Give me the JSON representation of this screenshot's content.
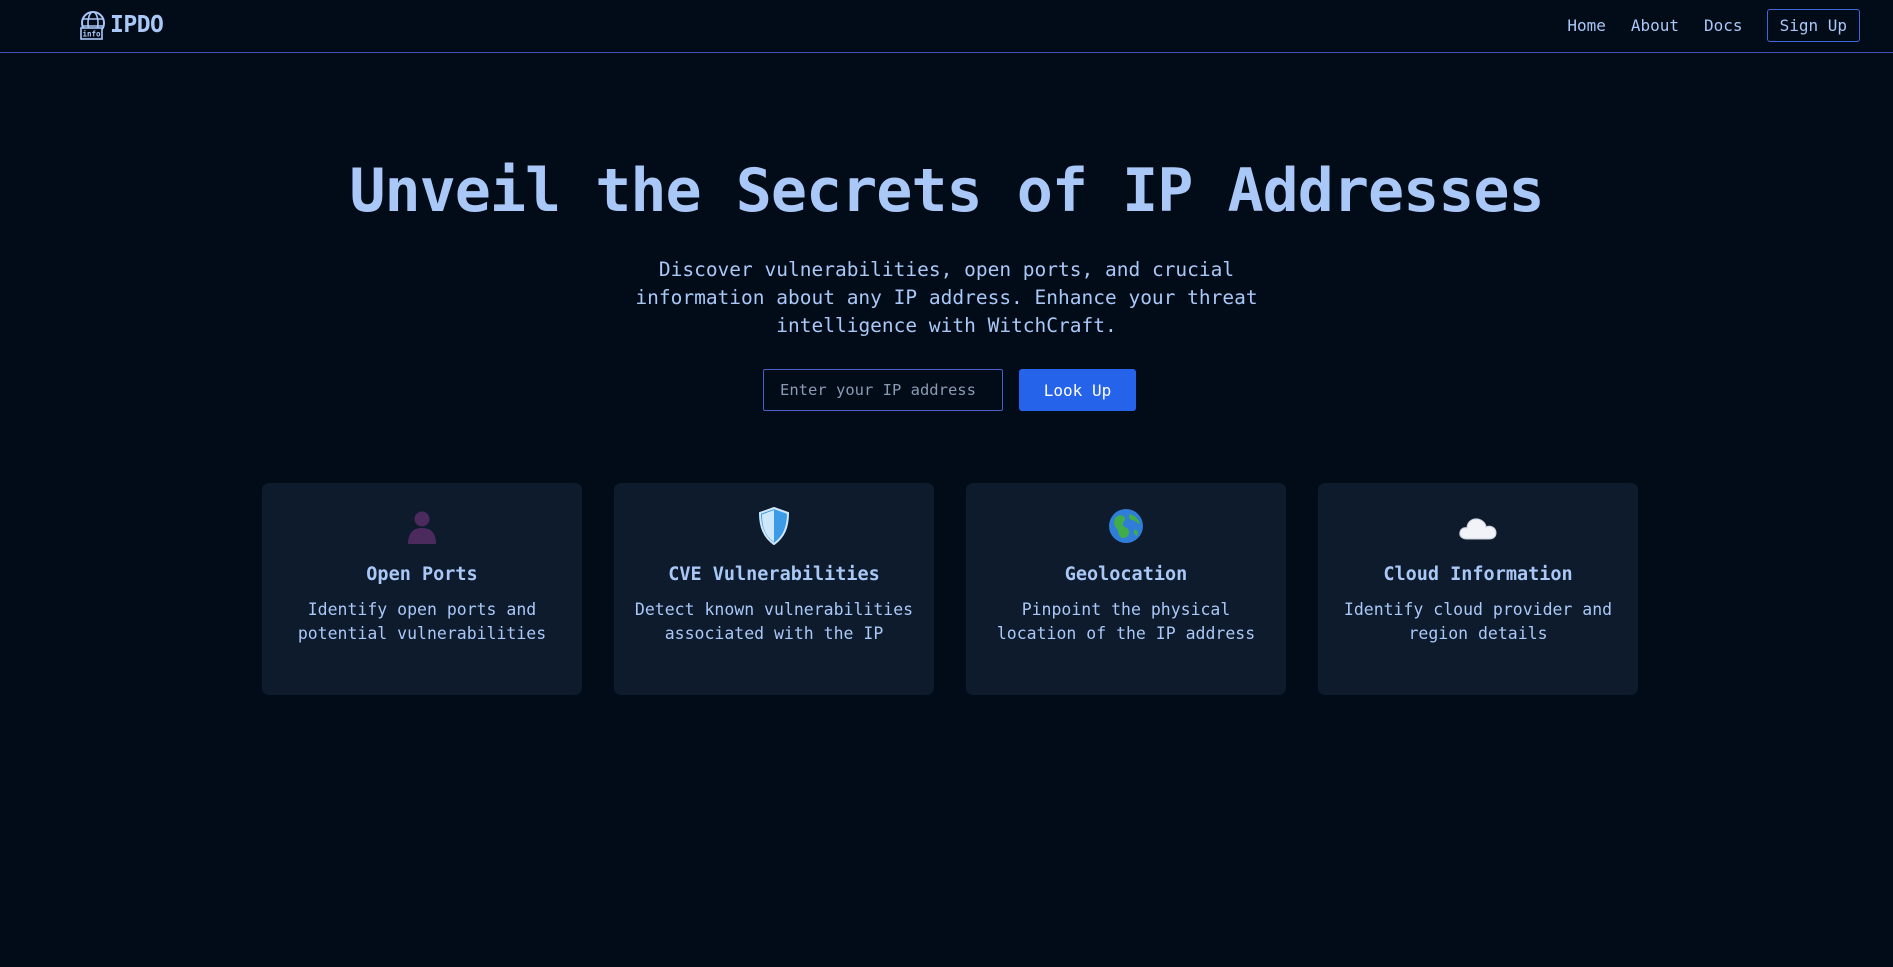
{
  "nav": {
    "brand": "IPDO",
    "brand_logo_text": "info",
    "links": [
      "Home",
      "About",
      "Docs"
    ],
    "signup_label": "Sign Up"
  },
  "hero": {
    "title": "Unveil the Secrets of IP Addresses",
    "subtitle": "Discover vulnerabilities, open ports, and crucial information about any IP address. Enhance your threat intelligence with WitchCraft."
  },
  "search": {
    "placeholder": "Enter your IP address",
    "value": "",
    "button_label": "Look Up"
  },
  "features": [
    {
      "icon": "person-silhouette-icon",
      "title": "Open Ports",
      "description": "Identify open ports and potential vulnerabilities"
    },
    {
      "icon": "shield-icon",
      "title": "CVE Vulnerabilities",
      "description": "Detect known vulnerabilities associated with the IP"
    },
    {
      "icon": "globe-icon",
      "title": "Geolocation",
      "description": "Pinpoint the physical location of the IP address"
    },
    {
      "icon": "cloud-icon",
      "title": "Cloud Information",
      "description": "Identify cloud provider and region details"
    }
  ],
  "colors": {
    "background": "#020b18",
    "text": "#a9c8f7",
    "card": "#0e1b2c",
    "accent": "#2563eb",
    "border": "#3f4fb8"
  }
}
